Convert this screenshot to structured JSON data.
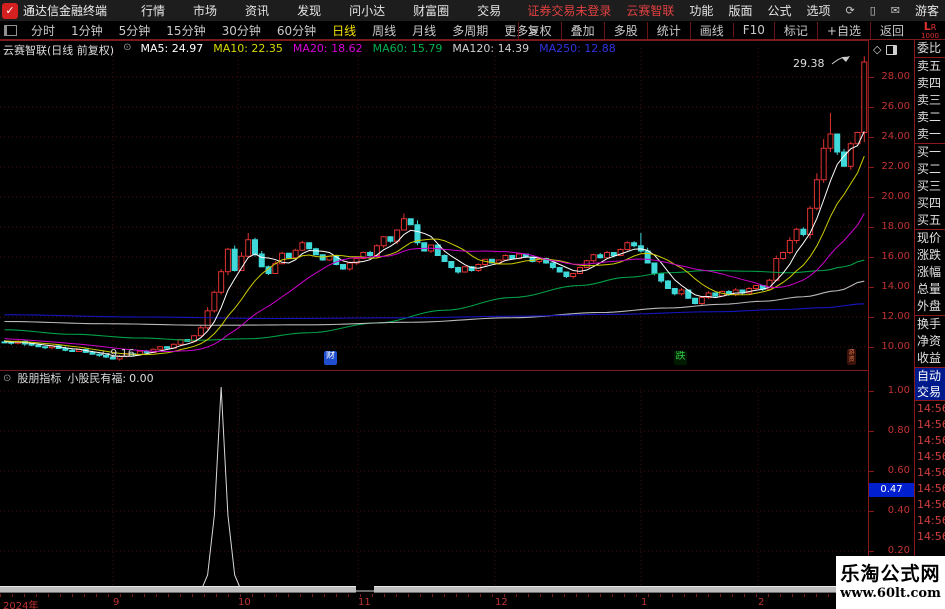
{
  "app": {
    "logo_glyph": "✓",
    "title": "通达信金融终端",
    "menu": [
      "行情",
      "市场",
      "资讯",
      "发现",
      "问小达",
      "财富圈",
      "交易"
    ],
    "login_warning": "证券交易未登录",
    "stock_shortcut": "云赛智联",
    "menu_right": [
      "功能",
      "版面",
      "公式",
      "选项"
    ],
    "icons": {
      "refresh": "⟳",
      "mobile": "▯",
      "mail": "✉"
    },
    "guest_label": "游客"
  },
  "toolbar": {
    "periods": [
      {
        "label": "分时",
        "active": false
      },
      {
        "label": "1分钟",
        "active": false
      },
      {
        "label": "5分钟",
        "active": false
      },
      {
        "label": "15分钟",
        "active": false
      },
      {
        "label": "30分钟",
        "active": false
      },
      {
        "label": "60分钟",
        "active": false
      },
      {
        "label": "日线",
        "active": true
      },
      {
        "label": "周线",
        "active": false
      },
      {
        "label": "月线",
        "active": false
      },
      {
        "label": "多周期",
        "active": false
      },
      {
        "label": "更多>",
        "active": false
      }
    ],
    "tools": [
      "复权",
      "叠加",
      "多股",
      "统计",
      "画线",
      "F10",
      "标记",
      "+自选",
      "返回"
    ],
    "speed": {
      "l": "L",
      "r": "R",
      "value": "1000"
    }
  },
  "chart_header": {
    "title": "云赛智联(日线 前复权)",
    "collapse_icon": "⊙",
    "mas": [
      {
        "label": "MA5:",
        "value": "24.97",
        "color": "#ffffff"
      },
      {
        "label": "MA10:",
        "value": "22.35",
        "color": "#d8d800"
      },
      {
        "label": "MA20:",
        "value": "18.62",
        "color": "#d800d8"
      },
      {
        "label": "MA60:",
        "value": "15.79",
        "color": "#00b050"
      },
      {
        "label": "MA120:",
        "value": "14.39",
        "color": "#cfcfcf"
      },
      {
        "label": "MA250:",
        "value": "12.88",
        "color": "#3232e0"
      }
    ]
  },
  "main_chart": {
    "price_axis": [
      28.0,
      26.0,
      24.0,
      22.0,
      20.0,
      18.0,
      16.0,
      14.0,
      12.0,
      10.0
    ],
    "high_annotation": "29.38",
    "low_annotation": "←9.16",
    "diamond_icon": "◇",
    "event_markers": [
      {
        "label": "财",
        "x": 324,
        "y": 351,
        "color": "#ffffff",
        "bg": "#1f4fd0",
        "fs": 9,
        "w": 13,
        "h": 14
      },
      {
        "label": "跌",
        "x": 674,
        "y": 351,
        "color": "#2ecc40",
        "bg": "#001a00",
        "fs": 10,
        "w": 13,
        "h": 14
      },
      {
        "label": "游资",
        "x": 847,
        "y": 349,
        "color": "#e0784b",
        "bg": "#3a120a",
        "fs": 6,
        "w": 9,
        "h": 16
      }
    ]
  },
  "indicator": {
    "collapse_icon": "⊙",
    "name": "股朋指标",
    "label": "小股民有福:",
    "value": "0.00",
    "axis": [
      1.0,
      0.8,
      0.6,
      0.4,
      0.2
    ],
    "cursor_value": "0.47"
  },
  "quote_panel": {
    "groups": [
      [
        "委比"
      ],
      [
        "卖五",
        "卖四",
        "卖三",
        "卖二",
        "卖一"
      ],
      [
        "买一",
        "买二",
        "买三",
        "买四",
        "买五"
      ],
      [
        "现价",
        "涨跌",
        "涨幅",
        "总量",
        "外盘"
      ],
      [
        "换手",
        "净资",
        "收益"
      ]
    ],
    "tabs": [
      "自动",
      "交易"
    ],
    "times": [
      "14:56",
      "14:56",
      "14:56",
      "14:56",
      "14:56",
      "14:56",
      "14:56",
      "14:56",
      "14:56"
    ]
  },
  "date_axis": {
    "labels": [
      {
        "text": "2024年",
        "x": 3,
        "grid": false
      },
      {
        "text": "9",
        "x": 113,
        "grid": true
      },
      {
        "text": "10",
        "x": 238,
        "grid": true
      },
      {
        "text": "11",
        "x": 358,
        "grid": true
      },
      {
        "text": "12",
        "x": 495,
        "grid": true
      },
      {
        "text": "1",
        "x": 641,
        "grid": true
      },
      {
        "text": "2",
        "x": 758,
        "grid": true
      }
    ]
  },
  "watermark": {
    "line1": "乐淘公式网",
    "line2": "www.60lt.com"
  },
  "chart_data": {
    "type": "candlestick",
    "title": "云赛智联 日线 前复权",
    "ylim": [
      9.0,
      29.5
    ],
    "x_range": "2024-09 to 2025-02",
    "up_color": "#e13232",
    "down_color": "#3fd9d9",
    "pre_history": [
      10.9,
      10.85,
      10.8,
      10.82,
      10.75,
      10.7,
      10.72,
      10.65,
      10.6,
      10.62,
      10.55,
      10.5,
      10.52,
      10.45,
      10.42,
      10.4,
      10.38,
      10.4,
      10.36,
      10.34
    ],
    "closes": [
      10.32,
      10.25,
      10.38,
      10.2,
      10.12,
      10.02,
      9.95,
      10.08,
      9.9,
      9.78,
      9.7,
      9.83,
      9.64,
      9.52,
      9.45,
      9.33,
      9.2,
      9.38,
      9.55,
      9.49,
      9.72,
      9.64,
      9.85,
      10.02,
      9.92,
      10.18,
      10.5,
      10.38,
      10.75,
      11.28,
      12.41,
      13.65,
      15.02,
      16.52,
      15.1,
      16.05,
      17.15,
      16.2,
      15.35,
      14.9,
      15.55,
      16.25,
      15.95,
      16.45,
      16.95,
      16.55,
      16.15,
      15.8,
      16.05,
      15.5,
      15.2,
      15.6,
      15.9,
      16.3,
      16.1,
      16.75,
      17.35,
      17.05,
      17.8,
      18.55,
      18.15,
      16.95,
      16.4,
      16.8,
      16.1,
      15.7,
      15.3,
      15.0,
      15.35,
      15.1,
      15.5,
      15.85,
      15.6,
      15.8,
      16.1,
      15.9,
      16.2,
      16.0,
      15.7,
      15.9,
      15.6,
      15.3,
      15.0,
      14.7,
      14.9,
      15.3,
      15.75,
      16.15,
      15.95,
      16.3,
      16.1,
      16.5,
      16.95,
      16.75,
      16.4,
      15.6,
      14.9,
      14.4,
      13.9,
      13.55,
      13.8,
      13.25,
      12.9,
      13.3,
      13.6,
      13.4,
      13.7,
      13.5,
      13.8,
      13.6,
      13.9,
      14.1,
      13.85,
      14.45,
      15.9,
      16.3,
      17.1,
      17.85,
      17.5,
      19.25,
      21.15,
      23.25,
      24.2,
      23.0,
      22.05,
      23.55,
      24.3,
      29.0
    ],
    "wick_overrides": {
      "16": {
        "low": 9.16
      },
      "36": {
        "high": 17.6
      },
      "59": {
        "high": 18.9
      },
      "94": {
        "high": 17.6
      },
      "122": {
        "high": 25.6
      },
      "127": {
        "high": 29.38
      }
    },
    "ma_short": [
      {
        "n": 5,
        "color": "#ffffff"
      },
      {
        "n": 10,
        "color": "#cccc00"
      },
      {
        "n": 20,
        "color": "#cc00cc"
      }
    ],
    "ma_long": [
      {
        "name": "MA60",
        "color": "#00a045",
        "points": [
          [
            0,
            11.15
          ],
          [
            10,
            10.85
          ],
          [
            20,
            10.6
          ],
          [
            28,
            10.45
          ],
          [
            36,
            10.55
          ],
          [
            45,
            10.95
          ],
          [
            55,
            11.6
          ],
          [
            65,
            12.45
          ],
          [
            75,
            13.3
          ],
          [
            85,
            14.1
          ],
          [
            92,
            14.65
          ],
          [
            98,
            14.95
          ],
          [
            104,
            15.1
          ],
          [
            110,
            15.05
          ],
          [
            116,
            14.95
          ],
          [
            121,
            15.1
          ],
          [
            124,
            15.35
          ],
          [
            127,
            15.79
          ]
        ]
      },
      {
        "name": "MA120",
        "color": "#b8b8b8",
        "points": [
          [
            0,
            11.7
          ],
          [
            15,
            11.55
          ],
          [
            30,
            11.45
          ],
          [
            45,
            11.48
          ],
          [
            60,
            11.65
          ],
          [
            75,
            11.95
          ],
          [
            88,
            12.3
          ],
          [
            98,
            12.6
          ],
          [
            106,
            12.85
          ],
          [
            112,
            13.05
          ],
          [
            118,
            13.35
          ],
          [
            123,
            13.75
          ],
          [
            127,
            14.39
          ]
        ]
      },
      {
        "name": "MA250",
        "color": "#1515c0",
        "points": [
          [
            0,
            12.15
          ],
          [
            20,
            12.0
          ],
          [
            40,
            11.9
          ],
          [
            60,
            11.95
          ],
          [
            75,
            12.05
          ],
          [
            90,
            12.18
          ],
          [
            105,
            12.35
          ],
          [
            115,
            12.5
          ],
          [
            121,
            12.62
          ],
          [
            127,
            12.88
          ]
        ]
      }
    ],
    "indicator_series": {
      "name": "小股民有福",
      "color": "#d8d8d8",
      "baseline": 0,
      "ylim": [
        0,
        1.05
      ],
      "spike_points": [
        [
          29,
          0
        ],
        [
          30,
          0.08
        ],
        [
          31,
          0.38
        ],
        [
          32,
          1.02
        ],
        [
          33,
          0.38
        ],
        [
          34,
          0.08
        ],
        [
          35,
          0
        ]
      ]
    }
  }
}
